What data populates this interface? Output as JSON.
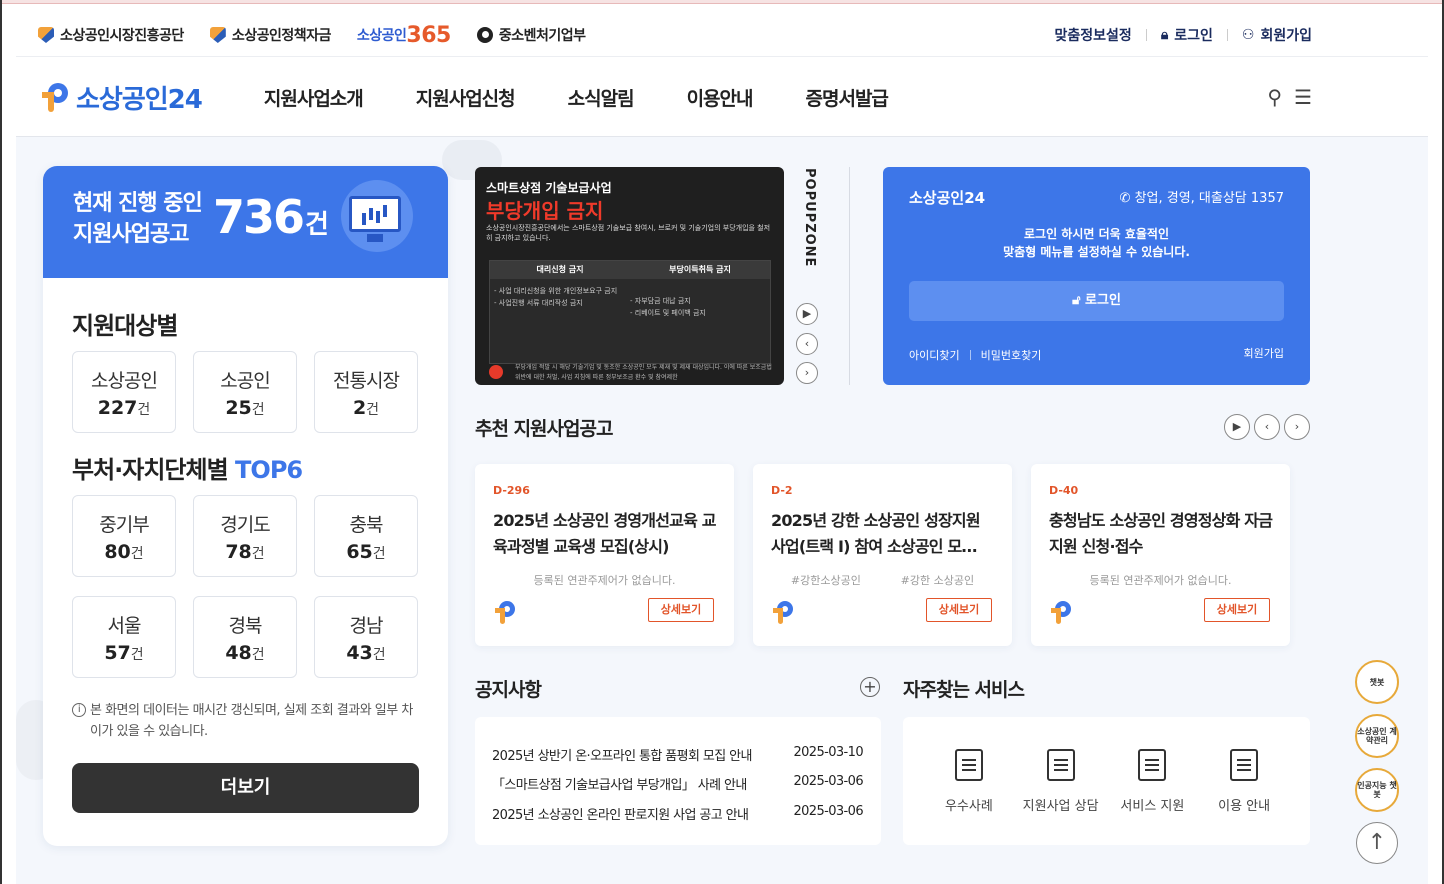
{
  "util": {
    "org1": "소상공인시장진흥공단",
    "org2": "소상공인정책자금",
    "org3_prefix": "소상공인",
    "org3_num": "365",
    "org4": "중소벤처기업부",
    "custom": "맞춤정보설정",
    "login": "로그인",
    "signup": "회원가입"
  },
  "gnb": {
    "logo": "소상공인24",
    "menu": [
      "지원사업소개",
      "지원사업신청",
      "소식알림",
      "이용안내",
      "증명서발급"
    ]
  },
  "summary": {
    "title_line1": "현재 진행 중인",
    "title_line2": "지원사업공고",
    "count": "736",
    "unit": "건"
  },
  "target": {
    "title": "지원대상별",
    "items": [
      {
        "label": "소상공인",
        "value": "227",
        "unit": "건"
      },
      {
        "label": "소공인",
        "value": "25",
        "unit": "건"
      },
      {
        "label": "전통시장",
        "value": "2",
        "unit": "건"
      }
    ]
  },
  "dept": {
    "title": "부처·자치단체별",
    "title_accent": "TOP6",
    "items": [
      {
        "label": "중기부",
        "value": "80",
        "unit": "건"
      },
      {
        "label": "경기도",
        "value": "78",
        "unit": "건"
      },
      {
        "label": "충북",
        "value": "65",
        "unit": "건"
      },
      {
        "label": "서울",
        "value": "57",
        "unit": "건"
      },
      {
        "label": "경북",
        "value": "48",
        "unit": "건"
      },
      {
        "label": "경남",
        "value": "43",
        "unit": "건"
      }
    ]
  },
  "info_note": "본 화면의 데이터는 매시간 갱신되며, 실제 조회 결과와 일부 차이가 있을 수 있습니다.",
  "more_button": "더보기",
  "banner": {
    "line1": "스마트상점 기술보급사업",
    "line2": "부당개입 금지",
    "line3": "소상공인시장진흥공단에서는 스마트상점 기술보급 참여시, 브로커 및 기술기업의 부당개입을 철저히 금지하고 있습니다.",
    "col1": "대리신청 금지",
    "col2": "부당이득취득 금지",
    "col1_body": "- 사업 대리신청을 위한 개인정보요구 금지\n- 사업진행 서류 대리작성 금지",
    "col2_body": "- 자부담금 대납 금지\n- 리베이트 및 페이백 금지",
    "foot": "부당개입 적발 시 해당 기술기업 및 동조한 소상공인 모두 제재 및 제재 대상입니다. 이에 따른 보조금법 위반에 대한 처벌, 사업 지침에 따른 정부보조금 환수 및 참여제한"
  },
  "popupzone": "POPUPZONE",
  "login_card": {
    "brand": "소상공인24",
    "call": "창업, 경영, 대출상담 1357",
    "msg1": "로그인 하시면 더욱 효율적인",
    "msg2": "맞춤형 메뉴를 설정하실 수 있습니다.",
    "login_btn": "로그인",
    "find_id": "아이디찾기",
    "find_pw": "비밀번호찾기",
    "join": "회원가입"
  },
  "recommend": {
    "title": "추천 지원사업공고",
    "items": [
      {
        "dday": "D-296",
        "title": "2025년 소상공인 경영개선교육 교육과정별 교육생 모집(상시)",
        "tag1": "등록된 연관주제어가 없습니다.",
        "tag2": "",
        "detail": "상세보기"
      },
      {
        "dday": "D-2",
        "title": "2025년 강한 소상공인 성장지원 사업(트랙 Ⅰ) 참여 소상공인 모…",
        "tag1": "#강한소상공인",
        "tag2": "#강한 소상공인",
        "detail": "상세보기"
      },
      {
        "dday": "D-40",
        "title": "충청남도 소상공인 경영정상화 자금 지원 신청·접수",
        "tag1": "등록된 연관주제어가 없습니다.",
        "tag2": "",
        "detail": "상세보기"
      }
    ]
  },
  "notice": {
    "title": "공지사항",
    "rows": [
      {
        "text": "2025년 상반기 온·오프라인 통합 품평회 모집 안내",
        "date": "2025-03-10"
      },
      {
        "text": "「스마트상점 기술보급사업 부당개입」 사례 안내",
        "date": "2025-03-06"
      },
      {
        "text": "2025년 소상공인 온라인 판로지원 사업 공고 안내",
        "date": "2025-03-06"
      }
    ]
  },
  "services": {
    "title": "자주찾는 서비스",
    "items": [
      "우수사례",
      "지원사업 상담",
      "서비스 지원",
      "이용 안내"
    ]
  },
  "floating": {
    "chatbot": "챗봇",
    "contract": "소상공인 계약관리",
    "ai_chatbot": "인공지능 챗봇"
  },
  "colors": {
    "primary": "#3d76e8",
    "accent": "#e2552a",
    "dark_button": "#333333"
  }
}
